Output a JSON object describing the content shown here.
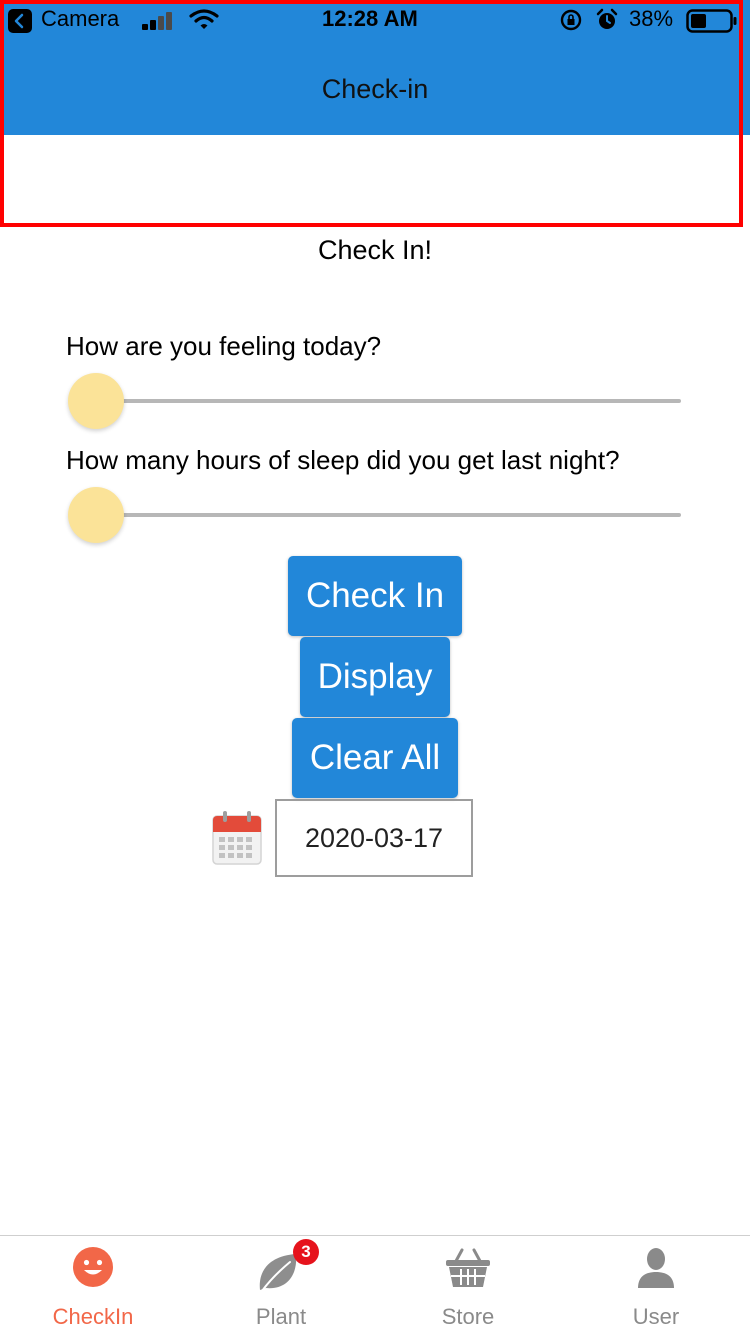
{
  "status_bar": {
    "back_app": "Camera",
    "time": "12:28 AM",
    "battery": "38%"
  },
  "header": {
    "title": "Check-in"
  },
  "page": {
    "heading": "Check In!"
  },
  "questions": [
    {
      "label": "How are you feeling today?",
      "slider_value": 0
    },
    {
      "label": "How many hours of sleep did you get last night?",
      "slider_value": 0
    }
  ],
  "buttons": {
    "check_in": "Check In",
    "display": "Display",
    "clear_all": "Clear All"
  },
  "date_picker": {
    "value": "2020-03-17",
    "icon": "calendar-icon"
  },
  "tabs": [
    {
      "label": "CheckIn",
      "icon": "smiley-icon",
      "active": true
    },
    {
      "label": "Plant",
      "icon": "leaf-icon",
      "badge": "3"
    },
    {
      "label": "Store",
      "icon": "basket-icon"
    },
    {
      "label": "User",
      "icon": "user-icon"
    }
  ],
  "colors": {
    "header_blue": "#2287d9",
    "active_tab": "#f26748",
    "inactive_tab": "#8a8a8a",
    "slider_thumb": "#fbe398",
    "badge": "#e6131c"
  }
}
